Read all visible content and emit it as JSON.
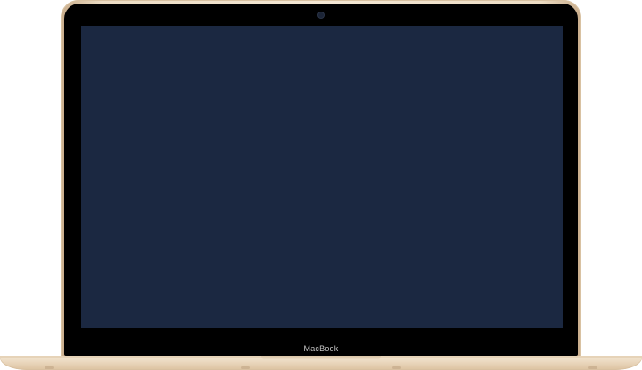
{
  "device": {
    "model_label": "MacBook",
    "finish_color": "#eddcc3",
    "bezel_color": "#000000",
    "screen_color": "#1b2841"
  }
}
